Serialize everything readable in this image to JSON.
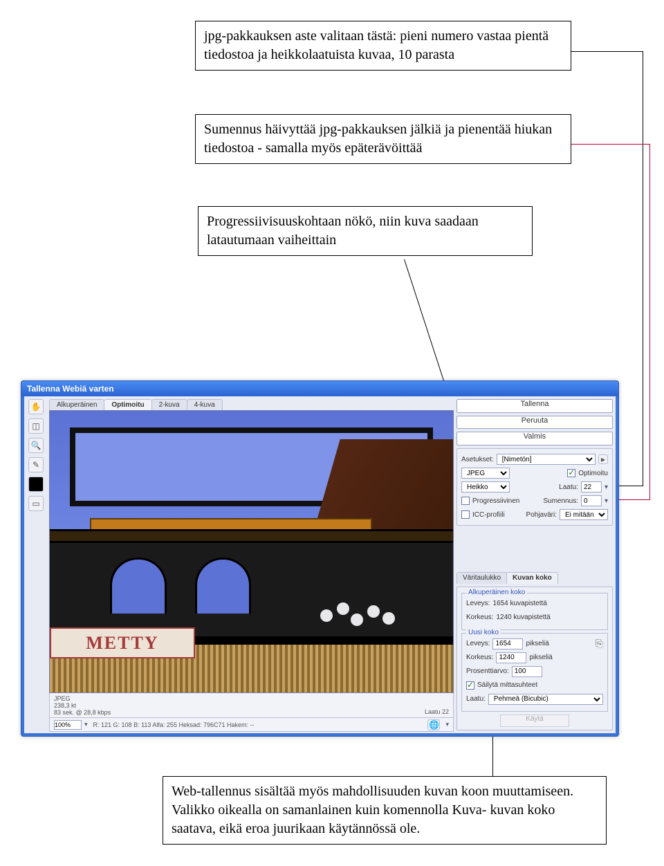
{
  "annotations": {
    "a1": "jpg-pakkauksen aste valitaan tästä:  pieni numero vastaa pientä tiedostoa ja heikkolaatuista kuvaa, 10 parasta",
    "a2": "Sumennus häivyttää jpg-pakkauksen jälkiä ja pienentää hiukan tiedostoa - samalla myös epäterävöittää",
    "a3": "Progressiivisuuskohtaan nökö, niin kuva saadaan latautumaan vaiheittain",
    "a4": "Web-tallennus sisältää myös mahdollisuuden kuvan koon muuttamiseen.  Valikko oikealla on samanlainen kuin komennolla Kuva- kuvan koko saatava, eikä eroa juurikaan käytännössä ole."
  },
  "dialog": {
    "title": "Tallenna Webiä varten",
    "tabs": {
      "t1": "Alkuperäinen",
      "t2": "Optimoitu",
      "t3": "2-kuva",
      "t4": "4-kuva"
    },
    "sign_text": "METTY",
    "info": {
      "format": "JPEG",
      "size": "238,3 kt",
      "time": "83 sek. @ 28,8 kbps",
      "quality_note": "Laatu 22"
    },
    "status": {
      "zoom": "100%",
      "readout": "R: 121  G: 108  B: 113  Alfa:   255  Heksad:   796C71  Hakem:   --"
    },
    "buttons": {
      "save": "Tallenna",
      "cancel": "Peruuta",
      "done": "Valmis"
    },
    "settings": {
      "preset_label": "Asetukset:",
      "preset_value": "[Nimetön]",
      "format": "JPEG",
      "optimized_label": "Optimoitu",
      "quality_label_left": "Heikko",
      "quality_label": "Laatu:",
      "quality_value": "22",
      "progressive_label": "Progressiivinen",
      "blur_label": "Sumennus:",
      "blur_value": "0",
      "icc_label": "ICC-profiili",
      "matte_label": "Pohjaväri:",
      "matte_value": "Ei mitään"
    },
    "right_tabs": {
      "t1": "Väritaulukko",
      "t2": "Kuvan koko"
    },
    "orig_size": {
      "group_title": "Alkuperäinen koko",
      "width_label": "Leveys:",
      "width_value": "1654 kuvapistettä",
      "height_label": "Korkeus:",
      "1240": "1240 kuvapistettä"
    },
    "new_size": {
      "group_title": "Uusi koko",
      "width_label": "Leveys:",
      "width_value": "1654",
      "width_unit": "pikseliä",
      "height_label": "Korkeus:",
      "height_value": "1240",
      "height_unit": "pikseliä",
      "percent_label": "Prosenttiarvo:",
      "percent_value": "100",
      "constrain_label": "Säilytä mittasuhteet",
      "resample_label": "Laatu:",
      "resample_value": "Pehmeä (Bicubic)"
    },
    "apply": "Käytä"
  }
}
